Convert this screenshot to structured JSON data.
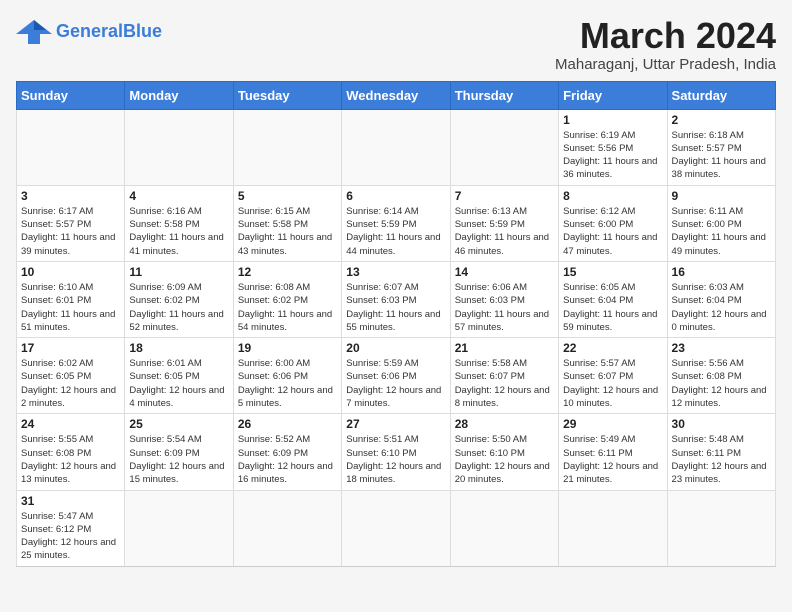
{
  "header": {
    "logo_general": "General",
    "logo_blue": "Blue",
    "month_year": "March 2024",
    "location": "Maharaganj, Uttar Pradesh, India"
  },
  "weekdays": [
    "Sunday",
    "Monday",
    "Tuesday",
    "Wednesday",
    "Thursday",
    "Friday",
    "Saturday"
  ],
  "weeks": [
    [
      {
        "day": "",
        "info": ""
      },
      {
        "day": "",
        "info": ""
      },
      {
        "day": "",
        "info": ""
      },
      {
        "day": "",
        "info": ""
      },
      {
        "day": "",
        "info": ""
      },
      {
        "day": "1",
        "info": "Sunrise: 6:19 AM\nSunset: 5:56 PM\nDaylight: 11 hours and 36 minutes."
      },
      {
        "day": "2",
        "info": "Sunrise: 6:18 AM\nSunset: 5:57 PM\nDaylight: 11 hours and 38 minutes."
      }
    ],
    [
      {
        "day": "3",
        "info": "Sunrise: 6:17 AM\nSunset: 5:57 PM\nDaylight: 11 hours and 39 minutes."
      },
      {
        "day": "4",
        "info": "Sunrise: 6:16 AM\nSunset: 5:58 PM\nDaylight: 11 hours and 41 minutes."
      },
      {
        "day": "5",
        "info": "Sunrise: 6:15 AM\nSunset: 5:58 PM\nDaylight: 11 hours and 43 minutes."
      },
      {
        "day": "6",
        "info": "Sunrise: 6:14 AM\nSunset: 5:59 PM\nDaylight: 11 hours and 44 minutes."
      },
      {
        "day": "7",
        "info": "Sunrise: 6:13 AM\nSunset: 5:59 PM\nDaylight: 11 hours and 46 minutes."
      },
      {
        "day": "8",
        "info": "Sunrise: 6:12 AM\nSunset: 6:00 PM\nDaylight: 11 hours and 47 minutes."
      },
      {
        "day": "9",
        "info": "Sunrise: 6:11 AM\nSunset: 6:00 PM\nDaylight: 11 hours and 49 minutes."
      }
    ],
    [
      {
        "day": "10",
        "info": "Sunrise: 6:10 AM\nSunset: 6:01 PM\nDaylight: 11 hours and 51 minutes."
      },
      {
        "day": "11",
        "info": "Sunrise: 6:09 AM\nSunset: 6:02 PM\nDaylight: 11 hours and 52 minutes."
      },
      {
        "day": "12",
        "info": "Sunrise: 6:08 AM\nSunset: 6:02 PM\nDaylight: 11 hours and 54 minutes."
      },
      {
        "day": "13",
        "info": "Sunrise: 6:07 AM\nSunset: 6:03 PM\nDaylight: 11 hours and 55 minutes."
      },
      {
        "day": "14",
        "info": "Sunrise: 6:06 AM\nSunset: 6:03 PM\nDaylight: 11 hours and 57 minutes."
      },
      {
        "day": "15",
        "info": "Sunrise: 6:05 AM\nSunset: 6:04 PM\nDaylight: 11 hours and 59 minutes."
      },
      {
        "day": "16",
        "info": "Sunrise: 6:03 AM\nSunset: 6:04 PM\nDaylight: 12 hours and 0 minutes."
      }
    ],
    [
      {
        "day": "17",
        "info": "Sunrise: 6:02 AM\nSunset: 6:05 PM\nDaylight: 12 hours and 2 minutes."
      },
      {
        "day": "18",
        "info": "Sunrise: 6:01 AM\nSunset: 6:05 PM\nDaylight: 12 hours and 4 minutes."
      },
      {
        "day": "19",
        "info": "Sunrise: 6:00 AM\nSunset: 6:06 PM\nDaylight: 12 hours and 5 minutes."
      },
      {
        "day": "20",
        "info": "Sunrise: 5:59 AM\nSunset: 6:06 PM\nDaylight: 12 hours and 7 minutes."
      },
      {
        "day": "21",
        "info": "Sunrise: 5:58 AM\nSunset: 6:07 PM\nDaylight: 12 hours and 8 minutes."
      },
      {
        "day": "22",
        "info": "Sunrise: 5:57 AM\nSunset: 6:07 PM\nDaylight: 12 hours and 10 minutes."
      },
      {
        "day": "23",
        "info": "Sunrise: 5:56 AM\nSunset: 6:08 PM\nDaylight: 12 hours and 12 minutes."
      }
    ],
    [
      {
        "day": "24",
        "info": "Sunrise: 5:55 AM\nSunset: 6:08 PM\nDaylight: 12 hours and 13 minutes."
      },
      {
        "day": "25",
        "info": "Sunrise: 5:54 AM\nSunset: 6:09 PM\nDaylight: 12 hours and 15 minutes."
      },
      {
        "day": "26",
        "info": "Sunrise: 5:52 AM\nSunset: 6:09 PM\nDaylight: 12 hours and 16 minutes."
      },
      {
        "day": "27",
        "info": "Sunrise: 5:51 AM\nSunset: 6:10 PM\nDaylight: 12 hours and 18 minutes."
      },
      {
        "day": "28",
        "info": "Sunrise: 5:50 AM\nSunset: 6:10 PM\nDaylight: 12 hours and 20 minutes."
      },
      {
        "day": "29",
        "info": "Sunrise: 5:49 AM\nSunset: 6:11 PM\nDaylight: 12 hours and 21 minutes."
      },
      {
        "day": "30",
        "info": "Sunrise: 5:48 AM\nSunset: 6:11 PM\nDaylight: 12 hours and 23 minutes."
      }
    ],
    [
      {
        "day": "31",
        "info": "Sunrise: 5:47 AM\nSunset: 6:12 PM\nDaylight: 12 hours and 25 minutes."
      },
      {
        "day": "",
        "info": ""
      },
      {
        "day": "",
        "info": ""
      },
      {
        "day": "",
        "info": ""
      },
      {
        "day": "",
        "info": ""
      },
      {
        "day": "",
        "info": ""
      },
      {
        "day": "",
        "info": ""
      }
    ]
  ]
}
